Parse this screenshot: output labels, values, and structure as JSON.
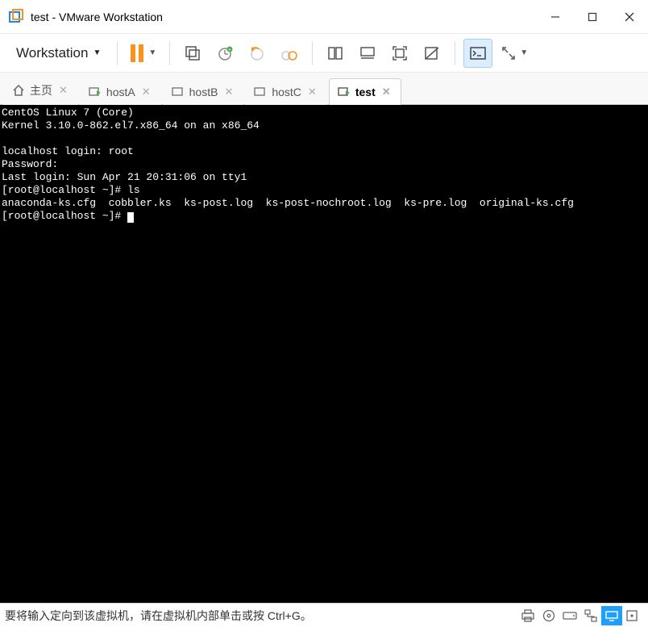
{
  "window": {
    "title": "test - VMware Workstation"
  },
  "menu": {
    "workstation": "Workstation"
  },
  "tabs": {
    "home": "主页",
    "items": [
      {
        "label": "hostA"
      },
      {
        "label": "hostB"
      },
      {
        "label": "hostC"
      },
      {
        "label": "test"
      }
    ],
    "active": "test"
  },
  "terminal": {
    "lines": [
      "CentOS Linux 7 (Core)",
      "Kernel 3.10.0-862.el7.x86_64 on an x86_64",
      "",
      "localhost login: root",
      "Password:",
      "Last login: Sun Apr 21 20:31:06 on tty1",
      "[root@localhost ~]# ls",
      "anaconda-ks.cfg  cobbler.ks  ks-post.log  ks-post-nochroot.log  ks-pre.log  original-ks.cfg",
      "[root@localhost ~]# "
    ]
  },
  "statusbar": {
    "message": "要将输入定向到该虚拟机，请在虚拟机内部单击或按 Ctrl+G。"
  }
}
